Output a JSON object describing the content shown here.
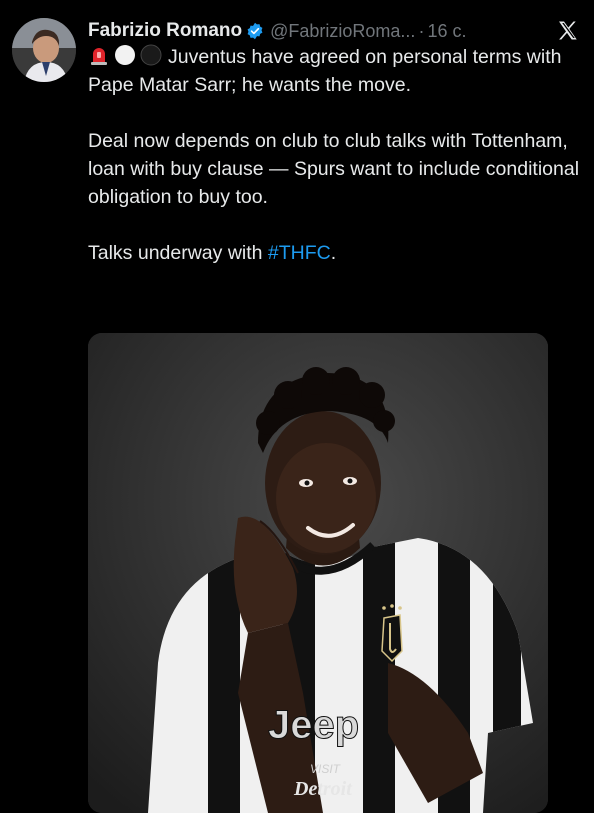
{
  "author": {
    "name": "Fabrizio Romano",
    "handle": "@FabrizioRoma...",
    "separator": "·",
    "time": "16 с."
  },
  "icons": {
    "verified": "verified-badge-icon",
    "platform": "x-logo-icon",
    "emojis": [
      "red-siren-emoji",
      "white-circle-emoji",
      "black-circle-emoji"
    ]
  },
  "tweet": {
    "line1": "Juventus have agreed on personal terms with Pape Matar Sarr; he wants the move.",
    "para2": "Deal now depends on club to club talks with Tottenham, loan with buy clause — Spurs want to include conditional obligation to buy too.",
    "para3_prefix": "Talks underway with ",
    "hashtag": "#THFC",
    "para3_suffix": "."
  },
  "media": {
    "shirt_sponsor": "Jeep",
    "sleeve_text_top": "VISIT",
    "sleeve_text_bottom": "Detroit"
  },
  "colors": {
    "background": "#000000",
    "text": "#e7e9ea",
    "secondary": "#71767b",
    "link": "#1d9bf0",
    "verified": "#1d9bf0"
  }
}
